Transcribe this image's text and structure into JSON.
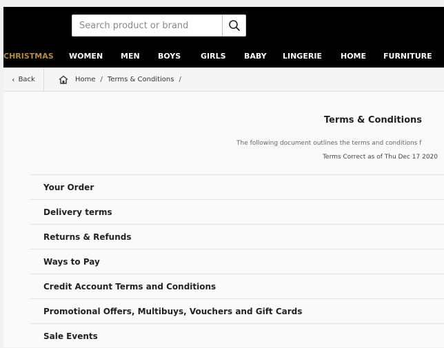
{
  "search": {
    "placeholder": "Search product or brand"
  },
  "nav": {
    "items": [
      "CHRISTMAS",
      "WOMEN",
      "MEN",
      "BOYS",
      "GIRLS",
      "BABY",
      "LINGERIE",
      "HOME",
      "FURNITURE"
    ],
    "accent_color": "#b38b47"
  },
  "breadcrumb": {
    "back_label": "Back",
    "items": [
      "Home",
      "Terms & Conditions"
    ]
  },
  "page": {
    "title": "Terms & Conditions",
    "intro": "The following document outlines the terms and conditions f",
    "correct_as_of": "Terms Correct as of Thu Dec 17 2020"
  },
  "sections": [
    "Your Order",
    "Delivery terms",
    "Returns & Refunds",
    "Ways to Pay",
    "Credit Account Terms and Conditions",
    "Promotional Offers, Multibuys, Vouchers and Gift Cards",
    "Sale Events"
  ]
}
